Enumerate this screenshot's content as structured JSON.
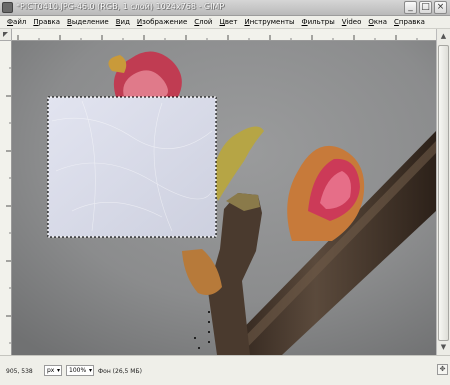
{
  "window": {
    "title": "*PICT0410.JPG-46.0 (RGB, 1 слой) 1024x768 - GIMP",
    "controls": {
      "minimize": "_",
      "maximize": "□",
      "close": "×"
    }
  },
  "menubar": {
    "items": [
      {
        "accel": "Ф",
        "rest": "айл"
      },
      {
        "accel": "П",
        "rest": "равка"
      },
      {
        "accel": "В",
        "rest": "ыделение"
      },
      {
        "accel": "В",
        "rest": "ид"
      },
      {
        "accel": "И",
        "rest": "зображение"
      },
      {
        "accel": "С",
        "rest": "лой"
      },
      {
        "accel": "Ц",
        "rest": "вет"
      },
      {
        "accel": "И",
        "rest": "нструменты"
      },
      {
        "accel": "Ф",
        "rest": "ильтры"
      },
      {
        "accel": "V",
        "rest": "ideo"
      },
      {
        "accel": "О",
        "rest": "кна"
      },
      {
        "accel": "С",
        "rest": "правка"
      }
    ]
  },
  "rulers": {
    "horizontal_labels": [
      "",
      "",
      "",
      "",
      "",
      "",
      "",
      "",
      "",
      ""
    ],
    "vertical_labels": [
      "",
      "",
      "",
      ""
    ]
  },
  "statusbar": {
    "coords": "905, 538",
    "unit": "px",
    "zoom": "100%",
    "message": "Фон (26,5 МБ)"
  },
  "colors": {
    "background_wall": "#8d8e8f",
    "selection_fill": "#d5d8e6",
    "bark_dark": "#3a2c22",
    "leaf_red": "#b8344a",
    "leaf_green": "#b4a63c"
  }
}
